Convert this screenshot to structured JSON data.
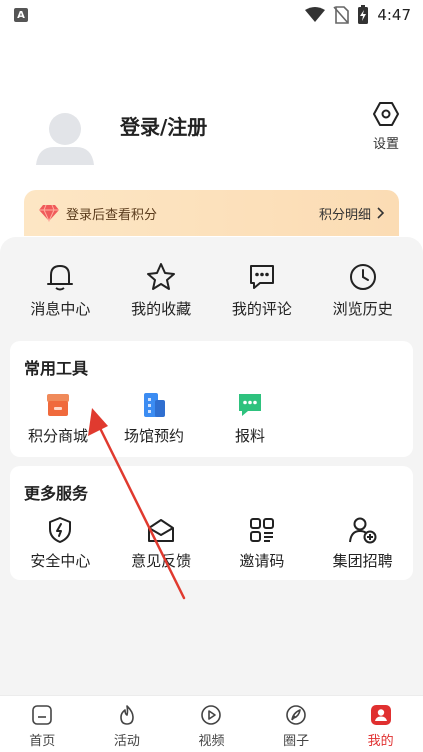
{
  "status_bar": {
    "time": "4:47",
    "badge": "A"
  },
  "profile": {
    "login_text": "登录/注册",
    "settings_label": "设置"
  },
  "points_banner": {
    "text": "登录后查看积分",
    "detail_link": "积分明细"
  },
  "quick_links": [
    {
      "label": "消息中心",
      "icon": "bell-icon"
    },
    {
      "label": "我的收藏",
      "icon": "star-icon"
    },
    {
      "label": "我的评论",
      "icon": "comment-icon"
    },
    {
      "label": "浏览历史",
      "icon": "clock-icon"
    }
  ],
  "tools": {
    "title": "常用工具",
    "items": [
      {
        "label": "积分商城",
        "icon": "shop-icon"
      },
      {
        "label": "场馆预约",
        "icon": "building-icon"
      },
      {
        "label": "报料",
        "icon": "chat-icon"
      }
    ]
  },
  "services": {
    "title": "更多服务",
    "items": [
      {
        "label": "安全中心",
        "icon": "shield-icon"
      },
      {
        "label": "意见反馈",
        "icon": "envelope-icon"
      },
      {
        "label": "邀请码",
        "icon": "qr-code-icon"
      },
      {
        "label": "集团招聘",
        "icon": "recruit-icon"
      }
    ]
  },
  "tabbar": [
    {
      "label": "首页",
      "icon": "home-icon",
      "active": false
    },
    {
      "label": "活动",
      "icon": "flame-icon",
      "active": false
    },
    {
      "label": "视频",
      "icon": "play-icon",
      "active": false
    },
    {
      "label": "圈子",
      "icon": "feather-icon",
      "active": false
    },
    {
      "label": "我的",
      "icon": "user-icon",
      "active": true
    }
  ],
  "colors": {
    "accent": "#e03030",
    "banner_bg": "#fde6c4",
    "page_bg": "#f4f4f4",
    "tool_orange": "#f07a4a",
    "tool_blue": "#3b8cf2",
    "tool_green": "#2ec27e"
  }
}
